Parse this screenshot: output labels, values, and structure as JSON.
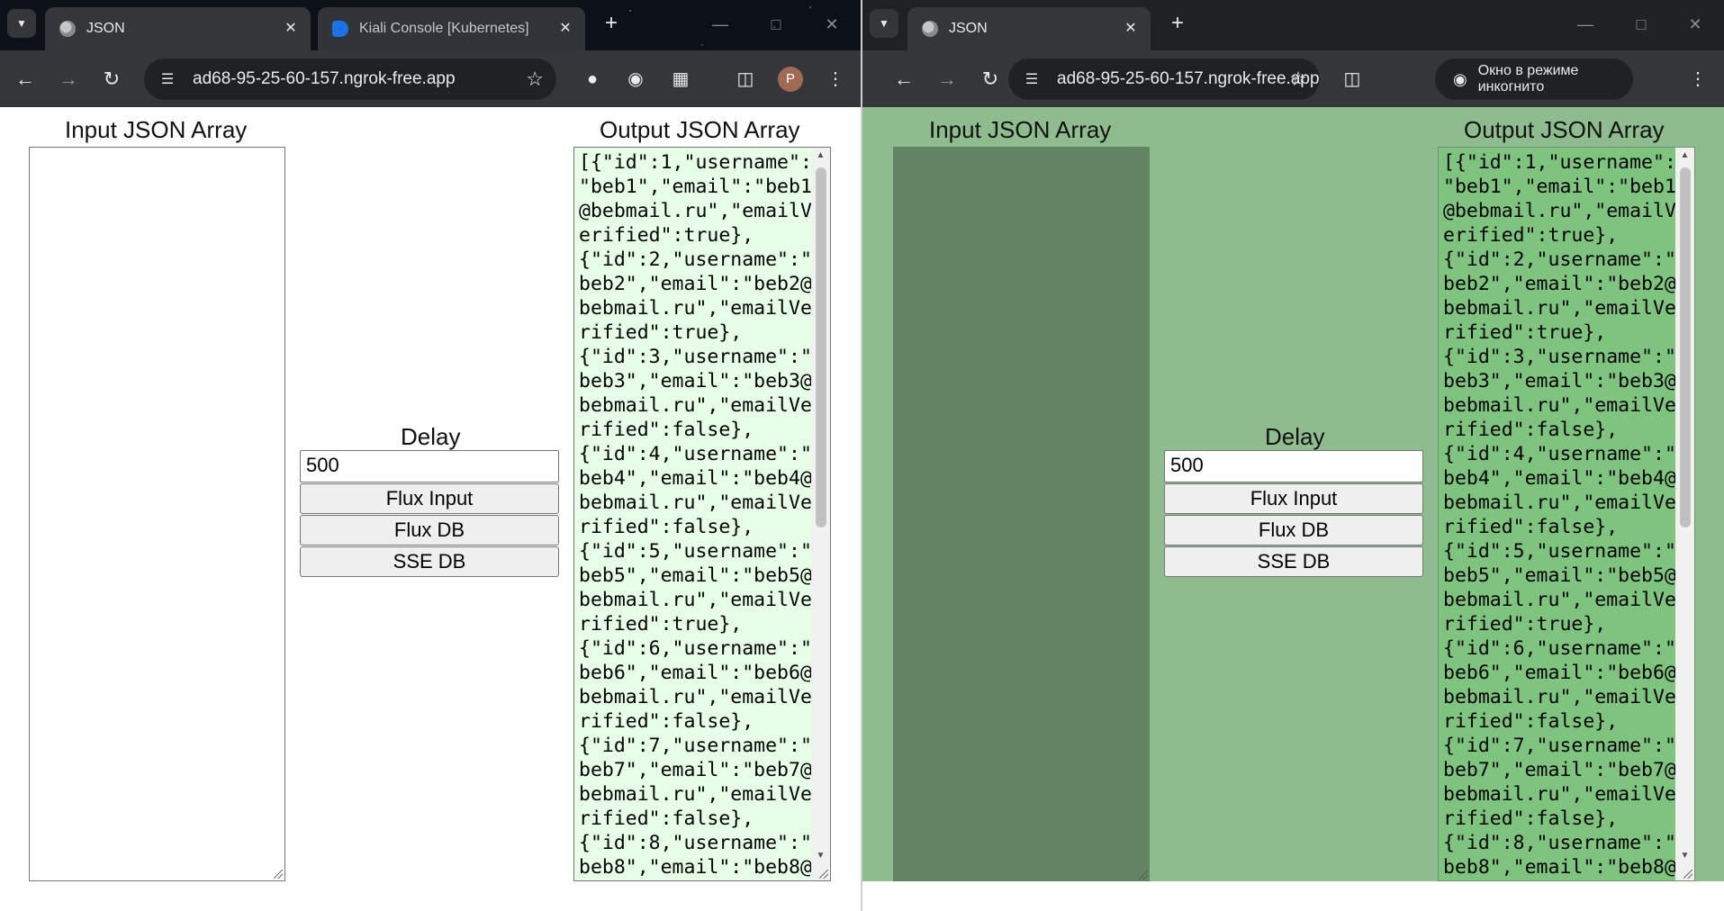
{
  "left_window": {
    "tabs": [
      {
        "title": "JSON",
        "active": true,
        "favicon": "globe-icon"
      },
      {
        "title": "Kiali Console [Kubernetes]",
        "active": false,
        "favicon": "kiali-icon"
      }
    ],
    "address": "ad68-95-25-60-157.ngrok-free.app",
    "avatar_letter": "P"
  },
  "right_window": {
    "tabs": [
      {
        "title": "JSON",
        "active": true,
        "favicon": "globe-icon"
      }
    ],
    "address": "ad68-95-25-60-157.ngrok-free.app",
    "incognito_label": "Окно в режиме инкогнито"
  },
  "page": {
    "input_label": "Input JSON Array",
    "output_label": "Output JSON Array",
    "delay_label": "Delay",
    "delay_value": "500",
    "buttons": {
      "flux_input": "Flux Input",
      "flux_db": "Flux DB",
      "sse_db": "SSE DB"
    },
    "output_text": "[{\"id\":1,\"username\":\n\"beb1\",\"email\":\"beb1\n@bebmail.ru\",\"emailV\nerified\":true},\n{\"id\":2,\"username\":\"\nbeb2\",\"email\":\"beb2@\nbebmail.ru\",\"emailVe\nrified\":true},\n{\"id\":3,\"username\":\"\nbeb3\",\"email\":\"beb3@\nbebmail.ru\",\"emailVe\nrified\":false},\n{\"id\":4,\"username\":\"\nbeb4\",\"email\":\"beb4@\nbebmail.ru\",\"emailVe\nrified\":false},\n{\"id\":5,\"username\":\"\nbeb5\",\"email\":\"beb5@\nbebmail.ru\",\"emailVe\nrified\":true},\n{\"id\":6,\"username\":\"\nbeb6\",\"email\":\"beb6@\nbebmail.ru\",\"emailVe\nrified\":false},\n{\"id\":7,\"username\":\"\nbeb7\",\"email\":\"beb7@\nbebmail.ru\",\"emailVe\nrified\":false},\n{\"id\":8,\"username\":\"\nbeb8\",\"email\":\"beb8@"
  },
  "colors": {
    "left_output_bg": "#e6ffe6",
    "right_page_bg": "#8fbc8f",
    "right_input_bg": "#648564",
    "right_output_bg": "#7ec47e"
  }
}
